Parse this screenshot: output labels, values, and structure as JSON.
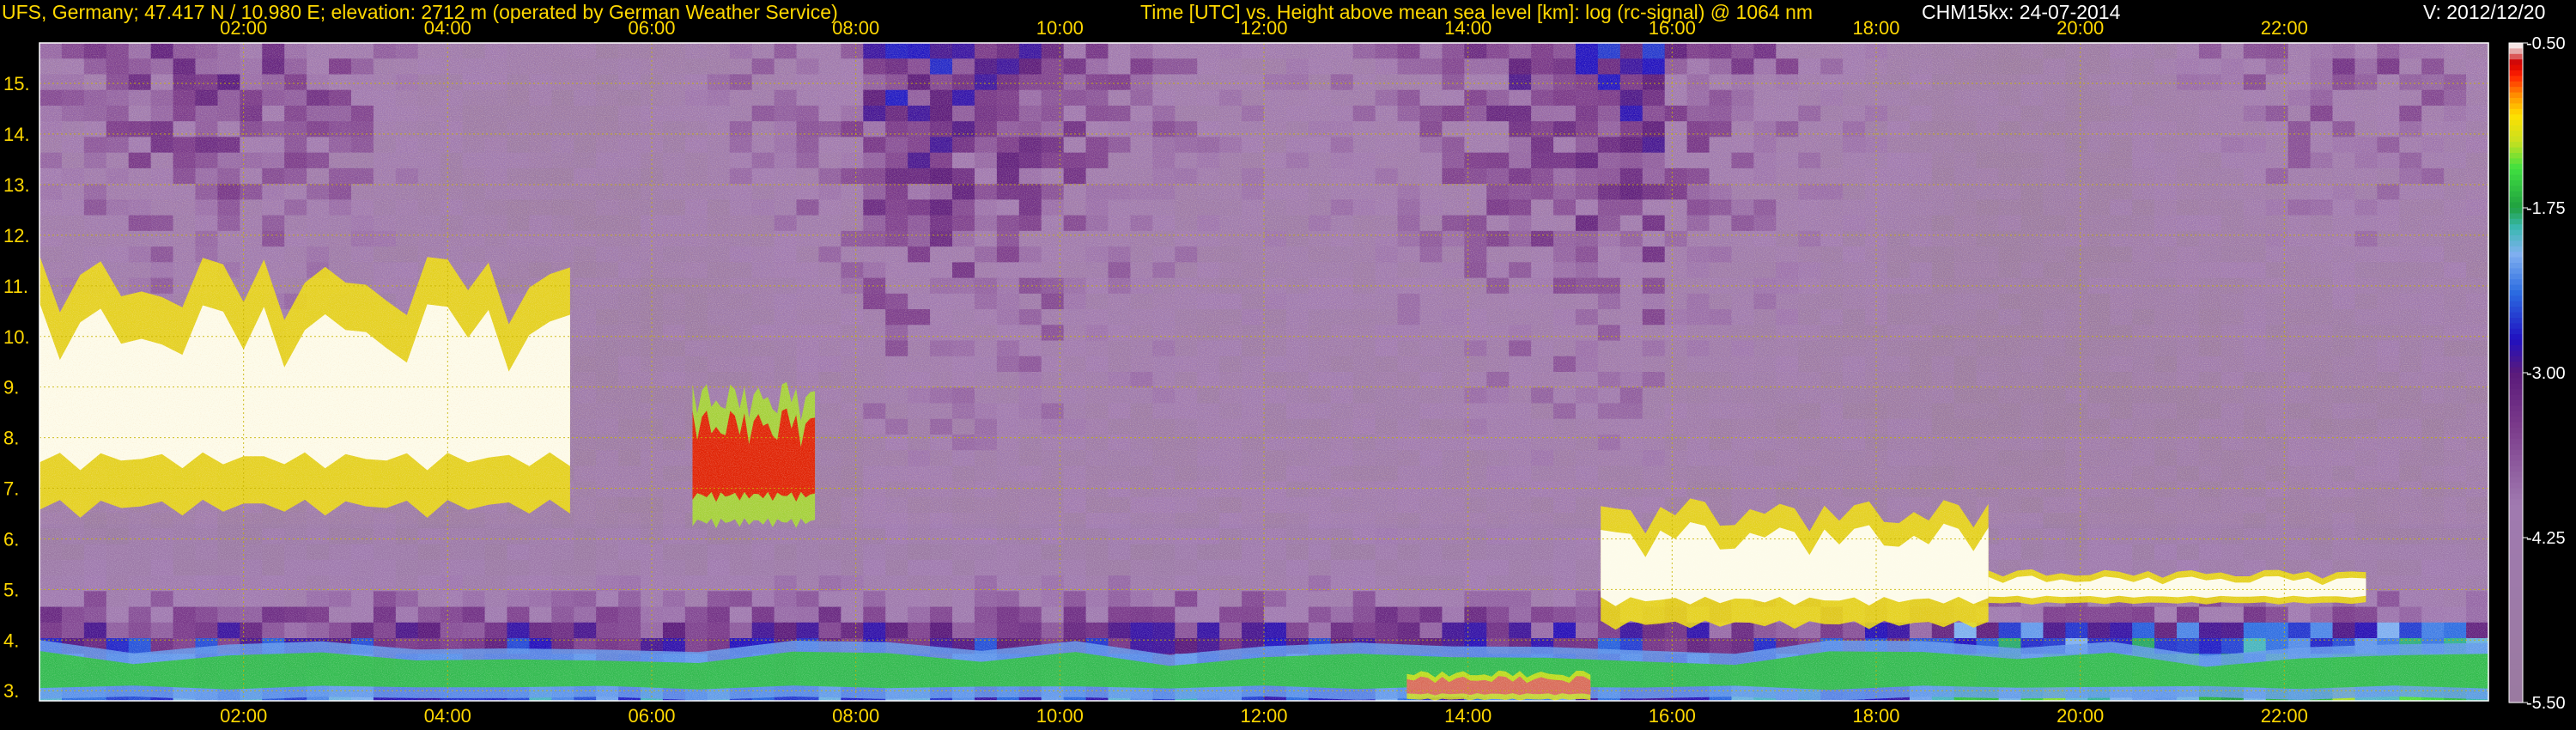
{
  "header": {
    "station": "UFS, Germany; 47.417 N / 10.980 E; elevation: 2712 m  (operated by German Weather Service)",
    "description": "Time [UTC] vs. Height above mean sea level [km]: log (rc-signal) @ 1064 nm",
    "instrument_date": "CHM15kx: 24-07-2014",
    "version": "V: 2012/12/20"
  },
  "colors": {
    "label_yellow": "#ffd800",
    "grid_yellow": "#c8b400",
    "background": "#000000"
  },
  "chart_data": {
    "type": "heatmap",
    "title": "Time [UTC] vs. Height above mean sea level [km]: log (rc-signal) @ 1064 nm",
    "xlabel": "Time [UTC]",
    "ylabel": "Height above mean sea level [km]",
    "x_ticks": [
      "02:00",
      "04:00",
      "06:00",
      "08:00",
      "10:00",
      "12:00",
      "14:00",
      "16:00",
      "18:00",
      "20:00",
      "22:00"
    ],
    "x_tick_hours": [
      2,
      4,
      6,
      8,
      10,
      12,
      14,
      16,
      18,
      20,
      22
    ],
    "xlim_hours": [
      0,
      24
    ],
    "y_ticks": [
      "3.",
      "4.",
      "5.",
      "6.",
      "7.",
      "8.",
      "9.",
      "10.",
      "11.",
      "12.",
      "13.",
      "14.",
      "15."
    ],
    "y_tick_values": [
      3,
      4,
      5,
      6,
      7,
      8,
      9,
      10,
      11,
      12,
      13,
      14,
      15
    ],
    "ylim_km": [
      2.8,
      15.8
    ],
    "grid": true,
    "colorbar": {
      "labels": [
        "-0.50",
        "-1.75",
        "-3.00",
        "-4.25",
        "-5.50"
      ],
      "values": [
        -0.5,
        -1.75,
        -3.0,
        -4.25,
        -5.5
      ],
      "range": [
        -5.5,
        -0.5
      ],
      "stops": [
        {
          "v": -5.5,
          "c": "#9a7aa0"
        },
        {
          "v": -4.0,
          "c": "#a07ab0"
        },
        {
          "v": -3.4,
          "c": "#7a3a8a"
        },
        {
          "v": -3.0,
          "c": "#5a1a7a"
        },
        {
          "v": -2.75,
          "c": "#2010c0"
        },
        {
          "v": -2.4,
          "c": "#2a6ae0"
        },
        {
          "v": -2.1,
          "c": "#80b0f0"
        },
        {
          "v": -1.9,
          "c": "#3ab8b0"
        },
        {
          "v": -1.75,
          "c": "#20a040"
        },
        {
          "v": -1.45,
          "c": "#40e040"
        },
        {
          "v": -1.25,
          "c": "#c8e020"
        },
        {
          "v": -1.05,
          "c": "#ffe000"
        },
        {
          "v": -0.9,
          "c": "#ff9000"
        },
        {
          "v": -0.75,
          "c": "#ff2000"
        },
        {
          "v": -0.65,
          "c": "#d00000"
        },
        {
          "v": -0.55,
          "c": "#e8c0c0"
        },
        {
          "v": -0.5,
          "c": "#ffffff"
        }
      ]
    },
    "features": [
      {
        "name": "high cirrus cloud",
        "start_h": 0.0,
        "end_h": 5.2,
        "base_km": 6.4,
        "top_km": 11.6,
        "log_signal": -0.5
      },
      {
        "name": "cloud patch",
        "start_h": 6.4,
        "end_h": 7.6,
        "base_km": 6.2,
        "top_km": 9.1,
        "log_signal": -0.7
      },
      {
        "name": "mid-level cloud",
        "start_h": 15.3,
        "end_h": 19.1,
        "base_km": 4.2,
        "top_km": 6.8,
        "log_signal": -0.5
      },
      {
        "name": "mid-level cloud",
        "start_h": 19.1,
        "end_h": 22.8,
        "base_km": 4.7,
        "top_km": 5.4,
        "log_signal": -0.5
      },
      {
        "name": "boundary layer",
        "start_h": 0.0,
        "end_h": 24.0,
        "base_km": 2.8,
        "top_km": 4.0,
        "log_signal": -1.6
      },
      {
        "name": "low cloud",
        "start_h": 13.4,
        "end_h": 15.2,
        "base_km": 2.8,
        "top_km": 3.4,
        "log_signal": -0.6
      }
    ]
  }
}
